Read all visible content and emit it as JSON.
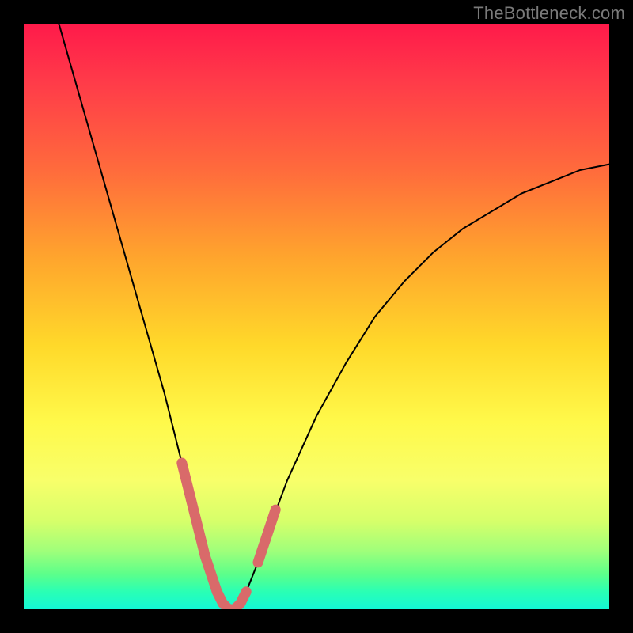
{
  "watermark": {
    "text": "TheBottleneck.com"
  },
  "chart_data": {
    "type": "line",
    "title": "",
    "xlabel": "",
    "ylabel": "",
    "xlim": [
      0,
      100
    ],
    "ylim": [
      0,
      100
    ],
    "grid": false,
    "legend": false,
    "series": [
      {
        "name": "curve",
        "color": "#000000",
        "x": [
          6,
          8,
          10,
          12,
          14,
          16,
          18,
          20,
          22,
          24,
          26,
          27,
          28,
          29,
          30,
          31,
          32,
          33,
          34,
          35,
          36,
          37,
          38,
          40,
          42,
          45,
          50,
          55,
          60,
          65,
          70,
          75,
          80,
          85,
          90,
          95,
          100
        ],
        "values": [
          100,
          93,
          86,
          79,
          72,
          65,
          58,
          51,
          44,
          37,
          29,
          25,
          21,
          17,
          13,
          9,
          6,
          3,
          1,
          0,
          0,
          1,
          3,
          8,
          14,
          22,
          33,
          42,
          50,
          56,
          61,
          65,
          68,
          71,
          73,
          75,
          76
        ]
      },
      {
        "name": "highlight-left",
        "color": "#d96a6a",
        "x": [
          27,
          28,
          29,
          30,
          31,
          32,
          33
        ],
        "values": [
          25,
          21,
          17,
          13,
          9,
          6,
          3
        ]
      },
      {
        "name": "highlight-bottom",
        "color": "#d96a6a",
        "x": [
          33,
          34,
          35,
          36,
          37,
          38
        ],
        "values": [
          3,
          1,
          0,
          0,
          1,
          3
        ]
      },
      {
        "name": "highlight-right",
        "color": "#d96a6a",
        "x": [
          40,
          41,
          42,
          43
        ],
        "values": [
          8,
          11,
          14,
          17
        ]
      }
    ],
    "gradient_background": {
      "type": "vertical",
      "stops": [
        {
          "pos": 0.0,
          "color": "#ff1a4a"
        },
        {
          "pos": 0.1,
          "color": "#ff3b49"
        },
        {
          "pos": 0.25,
          "color": "#ff6b3c"
        },
        {
          "pos": 0.4,
          "color": "#ffa52d"
        },
        {
          "pos": 0.55,
          "color": "#ffd92a"
        },
        {
          "pos": 0.68,
          "color": "#fff94a"
        },
        {
          "pos": 0.78,
          "color": "#f8ff6a"
        },
        {
          "pos": 0.85,
          "color": "#d6ff6a"
        },
        {
          "pos": 0.9,
          "color": "#a0ff7a"
        },
        {
          "pos": 0.94,
          "color": "#5cff8a"
        },
        {
          "pos": 0.97,
          "color": "#2affb4"
        },
        {
          "pos": 1.0,
          "color": "#13f7d6"
        }
      ]
    }
  }
}
